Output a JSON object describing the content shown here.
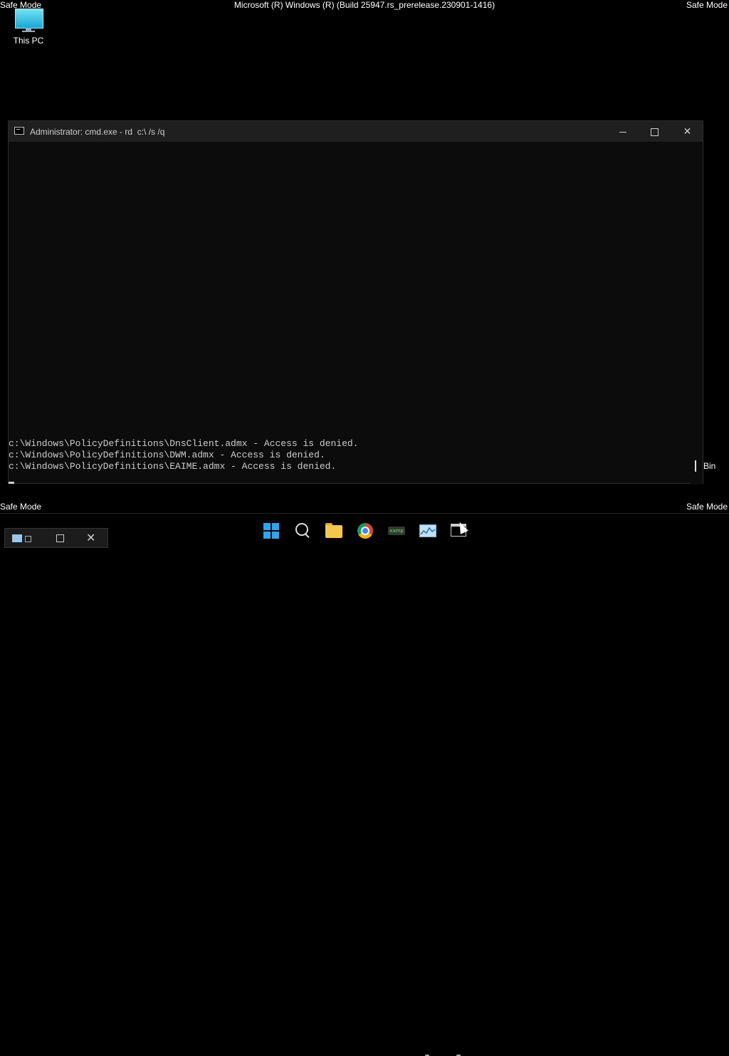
{
  "desktop": {
    "safe_mode_label": "Safe Mode",
    "build_text": "Microsoft (R) Windows (R) (Build 25947.rs_prerelease.230901-1416)",
    "icons": [
      {
        "label": "This PC",
        "icon": "monitor-icon"
      },
      {
        "label": "Bin",
        "icon": "recycle-bin-icon"
      }
    ]
  },
  "cmd_window": {
    "title": "Administrator: cmd.exe - rd  c:\\ /s /q",
    "controls": {
      "minimize": "minimize-icon",
      "maximize": "maximize-icon",
      "close": "close-icon"
    },
    "lines": [
      "c:\\Windows\\PolicyDefinitions\\DnsClient.admx - Access is denied.",
      "c:\\Windows\\PolicyDefinitions\\DWM.admx - Access is denied.",
      "c:\\Windows\\PolicyDefinitions\\EAIME.admx - Access is denied."
    ]
  },
  "taskbar": {
    "items": [
      {
        "name": "start",
        "icon": "windows-logo-icon"
      },
      {
        "name": "search",
        "icon": "search-icon"
      },
      {
        "name": "file-explorer",
        "icon": "folder-icon"
      },
      {
        "name": "chrome",
        "icon": "chrome-icon"
      },
      {
        "name": "xampp",
        "icon": "xampp-icon",
        "text": "xamp"
      },
      {
        "name": "performance-monitor",
        "icon": "performance-monitor-icon"
      },
      {
        "name": "command-prompt",
        "icon": "cmd-icon"
      }
    ],
    "thumbnail_controls": [
      "restore-icon",
      "maximize-icon",
      "close-icon"
    ]
  },
  "colors": {
    "accent": "#2aa6f5",
    "console_bg": "#0c0c0c",
    "console_fg": "#cccccc"
  }
}
